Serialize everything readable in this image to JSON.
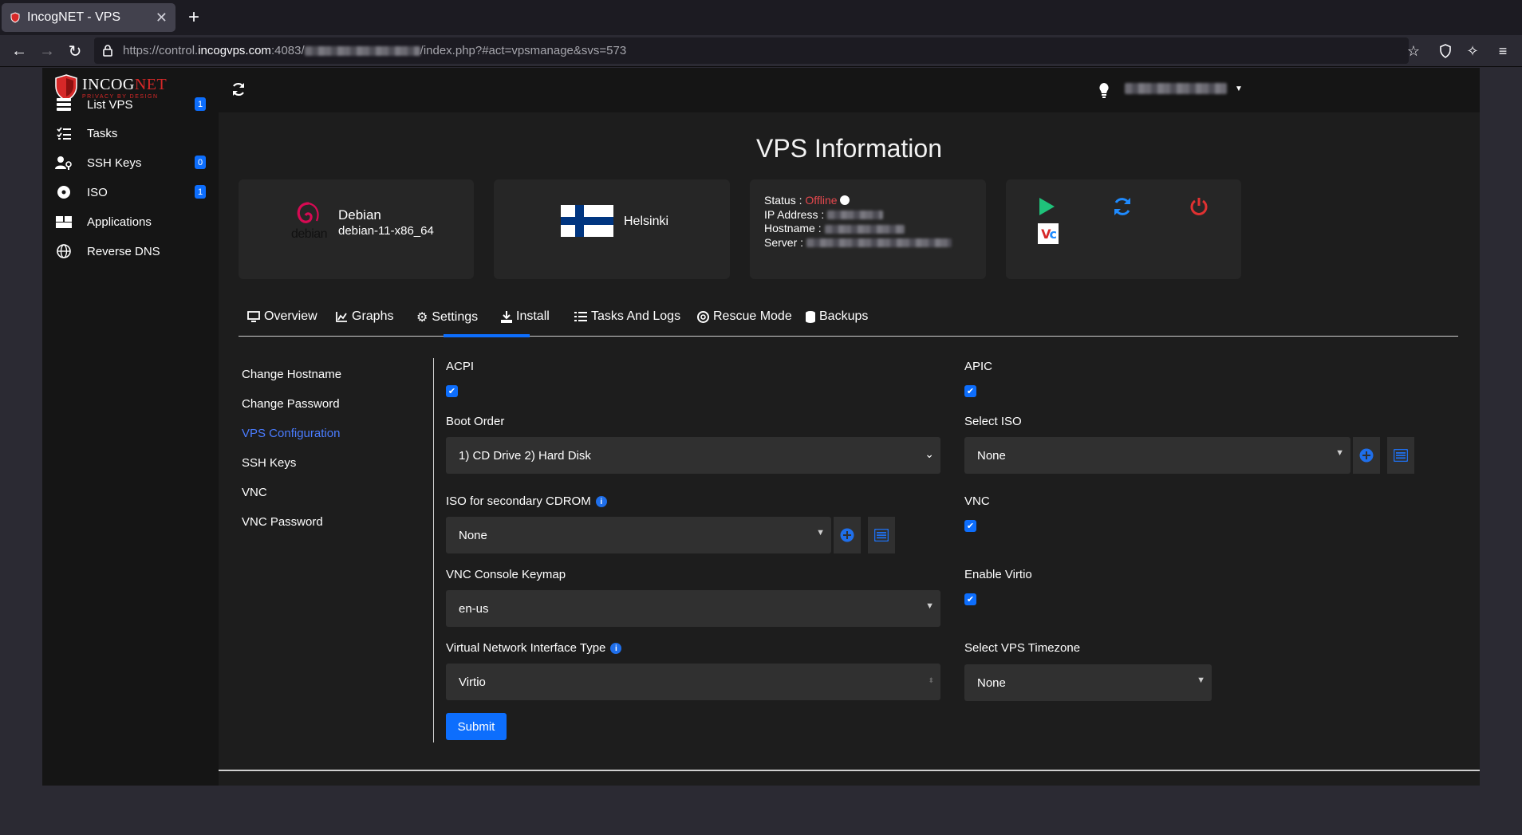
{
  "browser": {
    "tab_title": "IncogNET - VPS",
    "url_prefix": "https://control.",
    "url_host": "incogvps.com",
    "url_port": ":4083/",
    "url_path": "/index.php?#act=vpsmanage&svs=573"
  },
  "brand": {
    "name_part1": "INCOG",
    "name_part2": "NET",
    "tagline": "PRIVACY BY DESIGN"
  },
  "sidebar": {
    "items": [
      {
        "label": "List VPS",
        "badge": "1",
        "icon": "server-list-icon"
      },
      {
        "label": "Tasks",
        "badge": "",
        "icon": "tasks-icon"
      },
      {
        "label": "SSH Keys",
        "badge": "0",
        "icon": "user-key-icon"
      },
      {
        "label": "ISO",
        "badge": "1",
        "icon": "disc-icon"
      },
      {
        "label": "Applications",
        "badge": "",
        "icon": "boxes-icon"
      },
      {
        "label": "Reverse DNS",
        "badge": "",
        "icon": "globe-icon"
      }
    ]
  },
  "page": {
    "title": "VPS Information"
  },
  "os_card": {
    "name": "Debian",
    "template": "debian-11-x86_64",
    "logo_text": "debian"
  },
  "location_card": {
    "city": "Helsinki"
  },
  "status_card": {
    "status_label": "Status :",
    "status_value": "Offline",
    "ip_label": "IP Address :",
    "hostname_label": "Hostname :",
    "server_label": "Server :"
  },
  "colors": {
    "accent": "#0d6efd",
    "offline": "#e5484d",
    "start": "#1fc27a",
    "restart": "#1f8bff",
    "poweroff": "#e03131"
  },
  "tabs": [
    {
      "label": "Overview",
      "icon": "monitor-icon"
    },
    {
      "label": "Graphs",
      "icon": "chart-icon"
    },
    {
      "label": "Settings",
      "icon": "gear-icon",
      "active": true
    },
    {
      "label": "Install",
      "icon": "download-icon"
    },
    {
      "label": "Tasks And Logs",
      "icon": "list-icon"
    },
    {
      "label": "Rescue Mode",
      "icon": "lifering-icon"
    },
    {
      "label": "Backups",
      "icon": "database-icon"
    }
  ],
  "settings_nav": [
    {
      "label": "Change Hostname"
    },
    {
      "label": "Change Password"
    },
    {
      "label": "VPS Configuration",
      "active": true
    },
    {
      "label": "SSH Keys"
    },
    {
      "label": "VNC"
    },
    {
      "label": "VNC Password"
    }
  ],
  "form": {
    "acpi_label": "ACPI",
    "acpi_checked": true,
    "apic_label": "APIC",
    "apic_checked": true,
    "boot_order_label": "Boot Order",
    "boot_order_value": "1) CD Drive 2) Hard Disk",
    "select_iso_label": "Select ISO",
    "select_iso_value": "None",
    "secondary_cdrom_label": "ISO for secondary CDROM",
    "secondary_cdrom_value": "None",
    "vnc_label": "VNC",
    "vnc_checked": true,
    "keymap_label": "VNC Console Keymap",
    "keymap_value": "en-us",
    "virtio_label": "Enable Virtio",
    "virtio_checked": true,
    "nic_label": "Virtual Network Interface Type",
    "nic_value": "Virtio",
    "timezone_label": "Select VPS Timezone",
    "timezone_value": "None",
    "submit_label": "Submit"
  }
}
